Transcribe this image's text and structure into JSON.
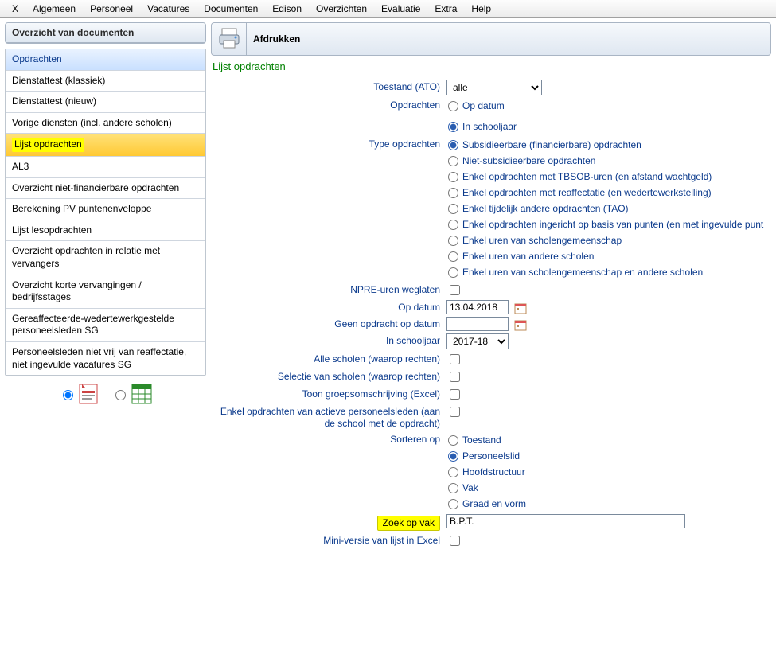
{
  "menu": {
    "items": [
      "X",
      "Algemeen",
      "Personeel",
      "Vacatures",
      "Documenten",
      "Edison",
      "Overzichten",
      "Evaluatie",
      "Extra",
      "Help"
    ]
  },
  "left": {
    "title": "Overzicht van documenten",
    "items": [
      {
        "label": "Opdrachten",
        "kind": "header"
      },
      {
        "label": "Dienstattest (klassiek)"
      },
      {
        "label": "Dienstattest (nieuw)"
      },
      {
        "label": "Vorige diensten (incl. andere scholen)"
      },
      {
        "label": "Lijst opdrachten",
        "kind": "selected"
      },
      {
        "label": "AL3"
      },
      {
        "label": "Overzicht niet-financierbare opdrachten"
      },
      {
        "label": "Berekening PV puntenenveloppe"
      },
      {
        "label": "Lijst lesopdrachten"
      },
      {
        "label": "Overzicht opdrachten in relatie met vervangers"
      },
      {
        "label": "Overzicht korte vervangingen / bedrijfsstages"
      },
      {
        "label": "Gereaffecteerde-wedertewerkgestelde personeelsleden SG"
      },
      {
        "label": "Personeelsleden niet vrij van reaffectatie, niet ingevulde vacatures SG"
      }
    ],
    "export": {
      "pdf": "PDF",
      "excel": "Excel"
    }
  },
  "right": {
    "toolbarTitle": "Afdrukken",
    "sectionTitle": "Lijst opdrachten",
    "labels": {
      "toestand": "Toestand (ATO)",
      "opdrachten": "Opdrachten",
      "typeOpdrachten": "Type opdrachten",
      "npre": "NPRE-uren weglaten",
      "opDatum": "Op datum",
      "geenOpdracht": "Geen opdracht op datum",
      "inSchooljaar": "In schooljaar",
      "alleScholen": "Alle scholen (waarop rechten)",
      "selectieScholen": "Selectie van scholen (waarop rechten)",
      "groepsomschrijving": "Toon groepsomschrijving (Excel)",
      "enkelActieve": "Enkel opdrachten van actieve personeelsleden   (aan de school met de opdracht)",
      "sorterenOp": "Sorteren op",
      "zoekOpVak": "Zoek op vak",
      "miniVersie": "Mini-versie van lijst in Excel"
    },
    "values": {
      "toestand": "alle",
      "opDatum": "13.04.2018",
      "geenOpdracht": "",
      "inSchooljaar": "2017-18",
      "zoekOpVak": "B.P.T."
    },
    "radios": {
      "opdrachten": [
        {
          "label": "Op datum",
          "checked": false
        },
        {
          "label": "In schooljaar",
          "checked": true
        }
      ],
      "typeOpdrachten": [
        {
          "label": "Subsidieerbare (financierbare) opdrachten",
          "checked": true
        },
        {
          "label": "Niet-subsidieerbare opdrachten",
          "checked": false
        },
        {
          "label": "Enkel opdrachten met TBSOB-uren (en afstand wachtgeld)",
          "checked": false
        },
        {
          "label": "Enkel opdrachten met reaffectatie (en wedertewerkstelling)",
          "checked": false
        },
        {
          "label": "Enkel tijdelijk andere opdrachten (TAO)",
          "checked": false
        },
        {
          "label": "Enkel opdrachten ingericht op basis van punten (en met ingevulde punt",
          "checked": false
        },
        {
          "label": "Enkel uren van scholengemeenschap",
          "checked": false
        },
        {
          "label": "Enkel uren van andere scholen",
          "checked": false
        },
        {
          "label": "Enkel uren van scholengemeenschap en andere scholen",
          "checked": false
        }
      ],
      "sorterenOp": [
        {
          "label": "Toestand",
          "checked": false
        },
        {
          "label": "Personeelslid",
          "checked": true
        },
        {
          "label": "Hoofdstructuur",
          "checked": false
        },
        {
          "label": "Vak",
          "checked": false
        },
        {
          "label": "Graad en vorm",
          "checked": false
        }
      ]
    },
    "checks": {
      "npre": false,
      "alleScholen": false,
      "selectieScholen": false,
      "groepsomschrijving": false,
      "enkelActieve": false,
      "miniVersie": false
    }
  }
}
